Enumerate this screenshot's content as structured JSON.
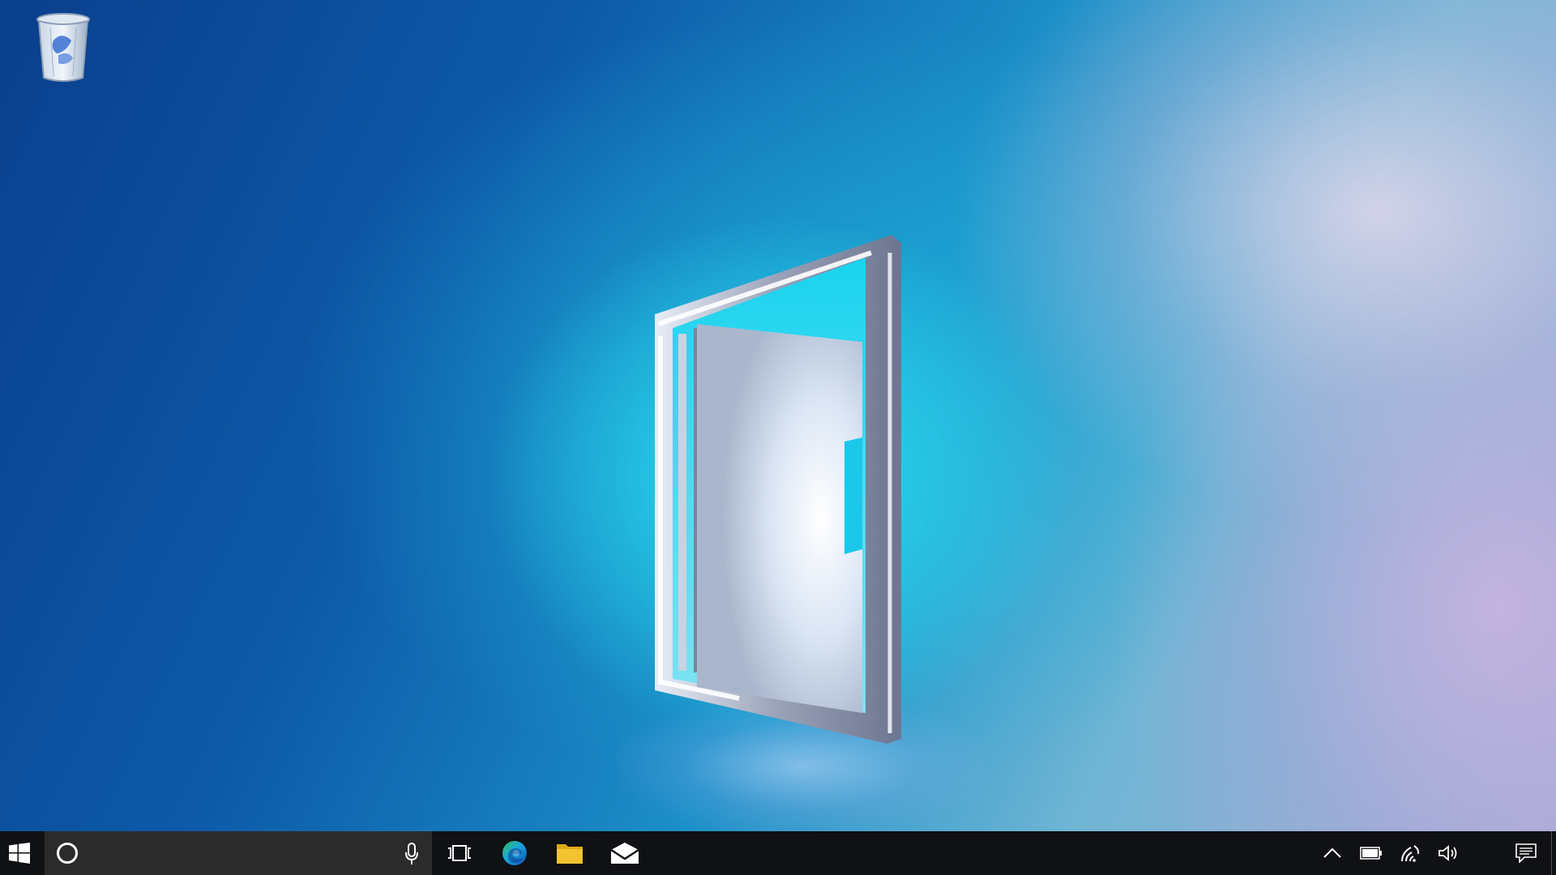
{
  "desktop": {
    "icons": [
      {
        "name": "recycle-bin",
        "label": ""
      }
    ]
  },
  "taskbar": {
    "start_icon": "windows-logo-icon",
    "search": {
      "placeholder": "",
      "value": "",
      "left_icon": "cortana-circle-icon",
      "right_icon": "microphone-icon"
    },
    "task_view_icon": "task-view-icon",
    "pinned_apps": [
      {
        "name": "edge",
        "icon": "edge-icon"
      },
      {
        "name": "file-explorer",
        "icon": "folder-icon"
      },
      {
        "name": "mail",
        "icon": "mail-icon"
      }
    ],
    "tray": [
      {
        "name": "hidden-icons",
        "icon": "chevron-up-icon"
      },
      {
        "name": "battery",
        "icon": "battery-icon"
      },
      {
        "name": "network",
        "icon": "wifi-icon"
      },
      {
        "name": "volume",
        "icon": "speaker-icon"
      },
      {
        "name": "action-center",
        "icon": "notification-icon"
      }
    ]
  },
  "colors": {
    "taskbar": "#101114",
    "search_box": "#2b2b2b",
    "folder": "#f4c430",
    "edge_blue": "#0c6fd1",
    "edge_green": "#35c15c"
  }
}
